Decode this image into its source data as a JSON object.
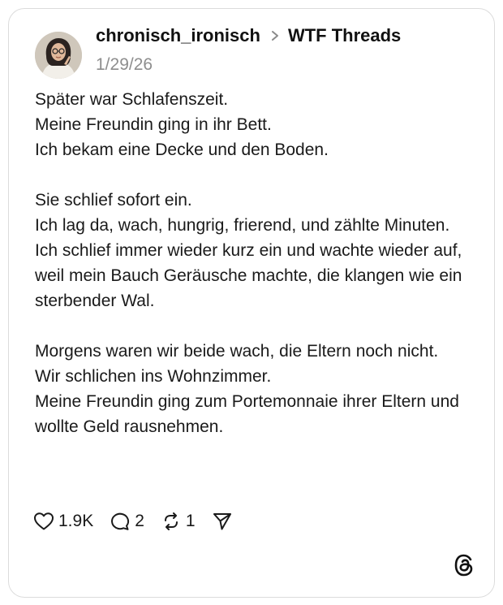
{
  "post": {
    "username": "chronisch_ironisch",
    "community": "WTF Threads",
    "date": "1/29/26",
    "paragraphs": [
      [
        "Später war Schlafenszeit.",
        "Meine Freundin ging in ihr Bett.",
        "Ich bekam eine Decke und den Boden."
      ],
      [
        "Sie schlief sofort ein.",
        "Ich lag da, wach, hungrig, frierend, und zählte Minuten.",
        "Ich schlief immer wieder kurz ein und wachte wieder auf, weil mein Bauch Geräusche machte, die klangen wie ein sterbender Wal."
      ],
      [
        "Morgens waren wir beide wach, die Eltern noch nicht.",
        "Wir schlichen ins Wohnzimmer.",
        "Meine Freundin ging zum Portemonnaie ihrer Eltern und wollte Geld rausnehmen."
      ]
    ]
  },
  "actions": {
    "likes": "1.9K",
    "replies": "2",
    "reposts": "1"
  },
  "icons": {
    "like": "heart-icon",
    "reply": "comment-icon",
    "repost": "repost-icon",
    "share": "send-icon",
    "brand": "threads-logo-icon",
    "separator": "chevron-right-icon"
  }
}
